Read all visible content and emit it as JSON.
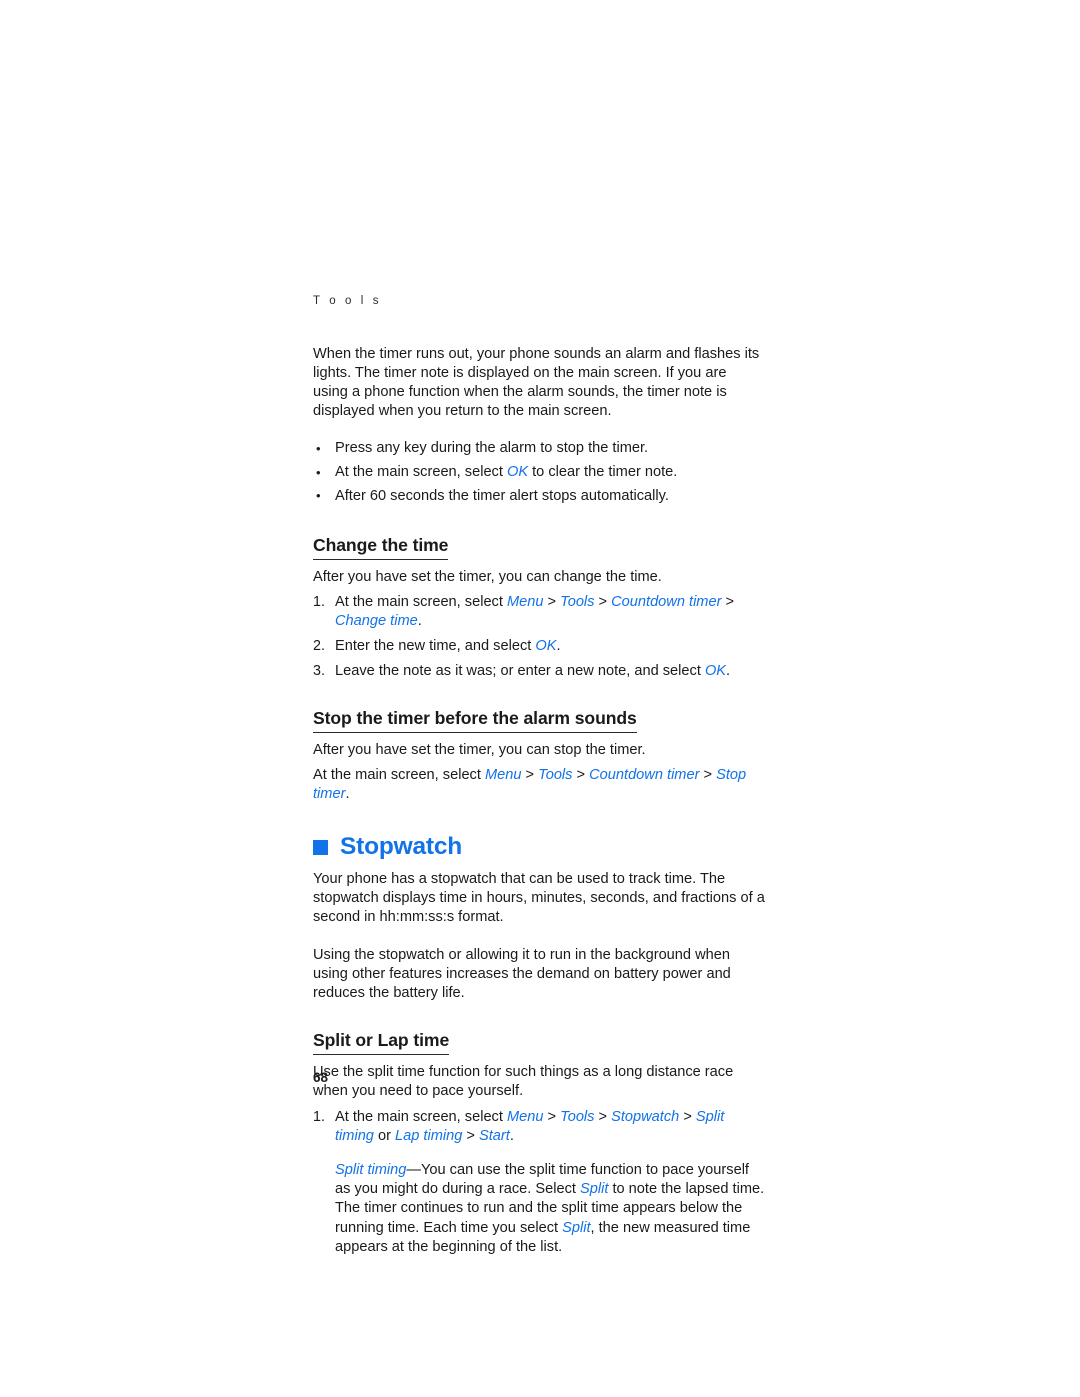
{
  "document": {
    "running_head": "T o o l s",
    "page_number": "68",
    "accent_color": "#1272e8",
    "text_color": "#1a1a1a"
  },
  "intro": {
    "paragraph": "When the timer runs out, your phone sounds an alarm and flashes its lights. The timer note is displayed on the main screen. If you are using a phone function when the alarm sounds, the timer note is displayed when you return to the main screen.",
    "bullets": [
      {
        "before": "Press any key during the alarm to stop the timer.",
        "term": "",
        "after": ""
      },
      {
        "before": "At the main screen, select ",
        "term": "OK",
        "after": " to clear the timer note."
      },
      {
        "before": "After 60 seconds the timer alert stops automatically.",
        "term": "",
        "after": ""
      }
    ]
  },
  "change_time": {
    "heading": "Change the time",
    "intro": "After you have set the timer, you can change the time.",
    "steps": [
      {
        "lead": "At the main screen, select ",
        "path": [
          "Menu",
          "Tools",
          "Countdown timer",
          "Change time"
        ],
        "tail": "."
      },
      {
        "lead": "Enter the new time, and select ",
        "path": [
          "OK"
        ],
        "tail": "."
      },
      {
        "lead": "Leave the note as it was; or enter a new note, and select ",
        "path": [
          "OK"
        ],
        "tail": "."
      }
    ]
  },
  "stop_timer": {
    "heading": "Stop the timer before the alarm sounds",
    "intro": "After you have set the timer, you can stop the timer.",
    "instruction": {
      "lead": "At the main screen, select ",
      "path": [
        "Menu",
        "Tools",
        "Countdown timer",
        "Stop timer"
      ],
      "tail": "."
    }
  },
  "stopwatch": {
    "heading": "Stopwatch",
    "paragraph_1": "Your phone has a stopwatch that can be used to track time. The stopwatch displays time in hours, minutes, seconds, and fractions of a second in hh:mm:ss:s format.",
    "paragraph_2": "Using the stopwatch or allowing it to run in the background when using other features increases the demand on battery power and reduces the battery life."
  },
  "split_lap": {
    "heading": "Split or Lap time",
    "intro": "Use the split time function for such things as a long distance race when you need to pace yourself.",
    "step_1": {
      "lead": "At the main screen, select ",
      "path_a": [
        "Menu",
        "Tools",
        "Stopwatch",
        "Split timing"
      ],
      "conjunction": " or ",
      "path_b": [
        "Lap timing",
        "Start"
      ],
      "tail": "."
    },
    "split_note": {
      "term": "Split timing",
      "dash": "—",
      "part_1": "You can use the split time function to pace yourself as you might do during a race. Select ",
      "term_2": "Split",
      "part_2": " to note the lapsed time. The timer continues to run and the split time appears below the running time. Each time you select ",
      "term_3": "Split",
      "part_3": ", the new measured time appears at the beginning of the list."
    }
  }
}
